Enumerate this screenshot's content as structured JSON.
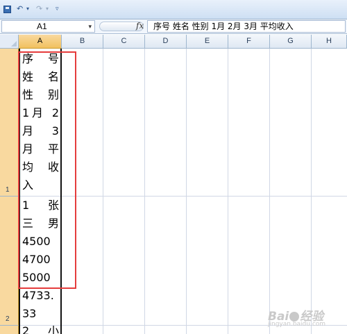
{
  "toolbar": {
    "undo_glyph": "↶",
    "redo_glyph": "↷",
    "dropdown_glyph": "▾",
    "customize_glyph": "▿"
  },
  "formula_bar": {
    "name_box": "A1",
    "fx_label": "fx",
    "content": "序号  姓名  性别  1月  2月  3月  平均收入"
  },
  "columns": [
    "A",
    "B",
    "C",
    "D",
    "E",
    "F",
    "G",
    "H"
  ],
  "rows": [
    "1",
    "2"
  ],
  "cell_A1_lines": [
    "序 号",
    "姓 名",
    "性 别",
    "1月 2",
    "月 3",
    "月 平",
    "均 收",
    "入"
  ],
  "cell_A2_lines": [
    "1 张",
    "三 男",
    "4500",
    "4700",
    "5000",
    "4733.",
    "33"
  ],
  "cell_A3_partial": "2 小",
  "watermark": {
    "brand_left": "Bai",
    "brand_right": "经验",
    "url": "jingyan.baidu.com"
  },
  "colors": {
    "highlight_box": "#e53c3c",
    "selected_header": "#f9d99f"
  }
}
